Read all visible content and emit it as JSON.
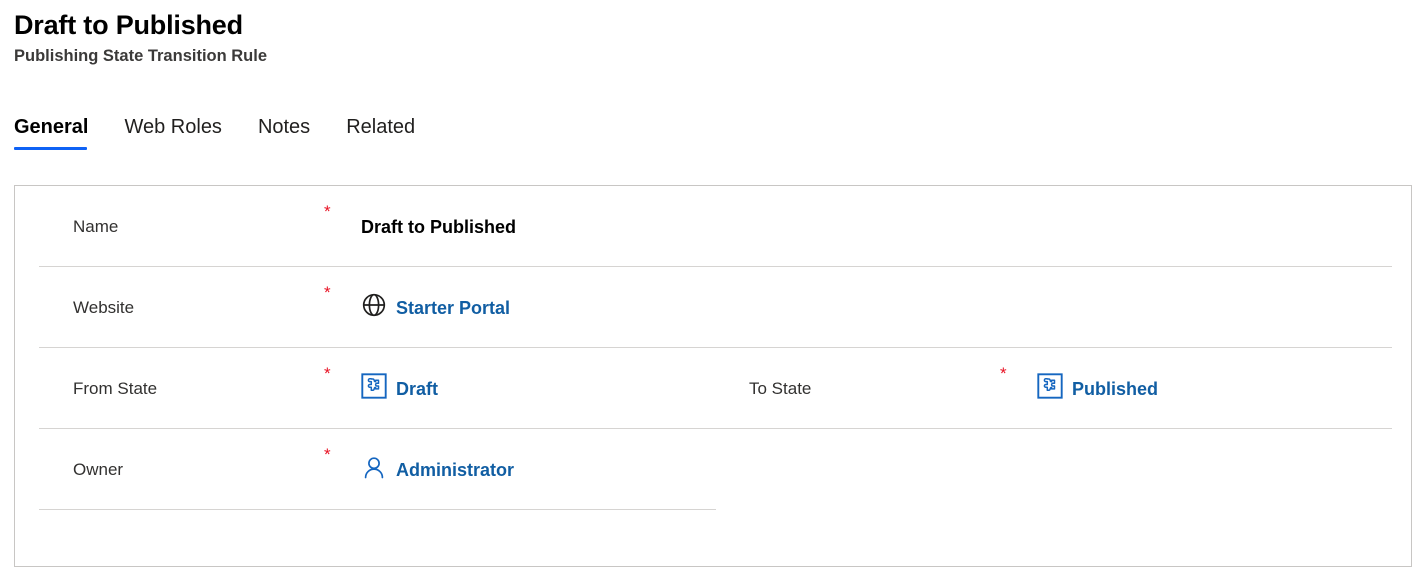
{
  "header": {
    "title": "Draft to Published",
    "subtitle": "Publishing State Transition Rule"
  },
  "tabs": [
    {
      "label": "General",
      "active": true
    },
    {
      "label": "Web Roles",
      "active": false
    },
    {
      "label": "Notes",
      "active": false
    },
    {
      "label": "Related",
      "active": false
    }
  ],
  "form": {
    "required_marker": "*",
    "rows": [
      {
        "fields": [
          {
            "label": "Name",
            "required": true,
            "value": "Draft to Published",
            "icon": null,
            "link": false
          }
        ]
      },
      {
        "fields": [
          {
            "label": "Website",
            "required": true,
            "value": "Starter Portal",
            "icon": "globe-icon",
            "link": true
          }
        ]
      },
      {
        "fields": [
          {
            "label": "From State",
            "required": true,
            "value": "Draft",
            "icon": "entity-puzzle-icon",
            "link": true
          },
          {
            "label": "To State",
            "required": true,
            "value": "Published",
            "icon": "entity-puzzle-icon",
            "link": true
          }
        ]
      },
      {
        "fields": [
          {
            "label": "Owner",
            "required": true,
            "value": "Administrator",
            "icon": "person-icon",
            "link": true
          }
        ]
      }
    ]
  },
  "colors": {
    "accent_blue": "#0f62f5",
    "link_blue": "#115ea3",
    "required_red": "#e81123",
    "card_border": "#c8c6c4",
    "divider": "#d6d4d2",
    "title_black": "#000000",
    "subtitle_gray": "#3b3a39"
  }
}
